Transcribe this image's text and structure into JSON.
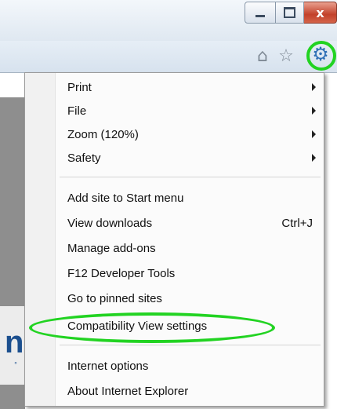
{
  "window_controls": {
    "minimize": "",
    "maximize": "",
    "close": "x"
  },
  "toolbar": {
    "home_icon": "home-icon",
    "favorites_icon": "star-icon",
    "tools_icon": "gear-icon"
  },
  "menu": {
    "groups": [
      [
        {
          "label": "Print",
          "submenu": true
        },
        {
          "label": "File",
          "submenu": true
        },
        {
          "label": "Zoom (120%)",
          "submenu": true
        },
        {
          "label": "Safety",
          "submenu": true
        }
      ],
      [
        {
          "label": "Add site to Start menu"
        },
        {
          "label": "View downloads",
          "shortcut": "Ctrl+J"
        },
        {
          "label": "Manage add-ons"
        },
        {
          "label": "F12 Developer Tools"
        },
        {
          "label": "Go to pinned sites"
        },
        {
          "label": "Compatibility View settings",
          "highlighted": true
        }
      ],
      [
        {
          "label": "Internet options"
        },
        {
          "label": "About Internet Explorer"
        }
      ]
    ]
  },
  "colors": {
    "highlight_ring": "#22d322",
    "gear_blue": "#2e6fb5",
    "close_red": "#c2412a"
  }
}
